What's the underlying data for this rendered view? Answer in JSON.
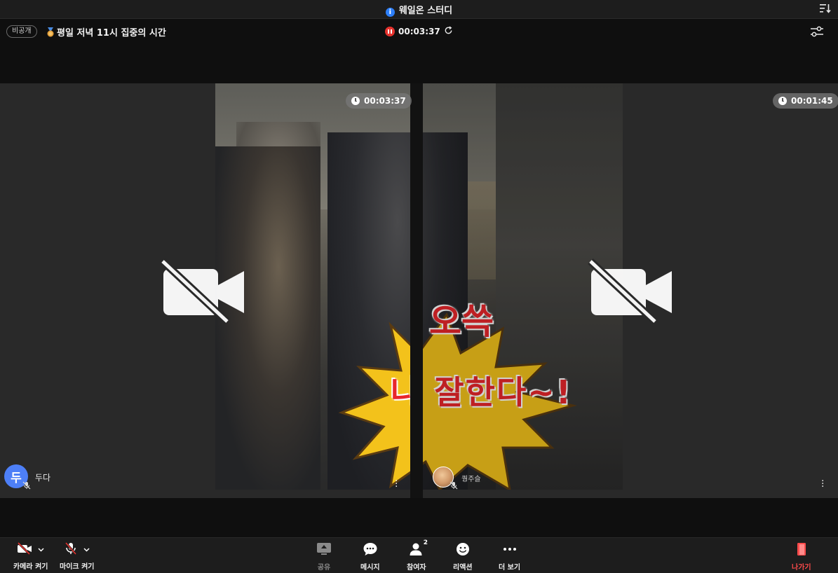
{
  "window": {
    "title": "웨일온 스터디",
    "info_icon": "i",
    "sort_icon": "sort-icon"
  },
  "header": {
    "visibility_badge": "비공개",
    "room_title": "평일 저녁 11시 집중의 시간",
    "timer": "00:03:37",
    "settings_icon": "sliders-icon"
  },
  "tiles": {
    "left": {
      "timer": "00:03:37",
      "participant_name": "두다",
      "avatar_initial": "두",
      "camera_status": "camera-off-icon"
    },
    "right": {
      "timer": "00:01:45",
      "participant_name": "퀑주슬",
      "camera_status": "camera-off-icon"
    }
  },
  "video_captions": {
    "line1": "오쓱",
    "line2": "나 잘한다~!"
  },
  "toolbar": {
    "camera": "카메라 켜기",
    "mic": "마이크 켜기",
    "share": "공유",
    "message": "메시지",
    "participants": "참여자",
    "participants_count": "2",
    "reaction": "리액션",
    "more": "더 보기",
    "leave": "나가기"
  },
  "colors": {
    "accent": "#4d7ff7",
    "record": "#e5322d",
    "leave": "#ff4b4b",
    "info": "#2d7ff9"
  }
}
